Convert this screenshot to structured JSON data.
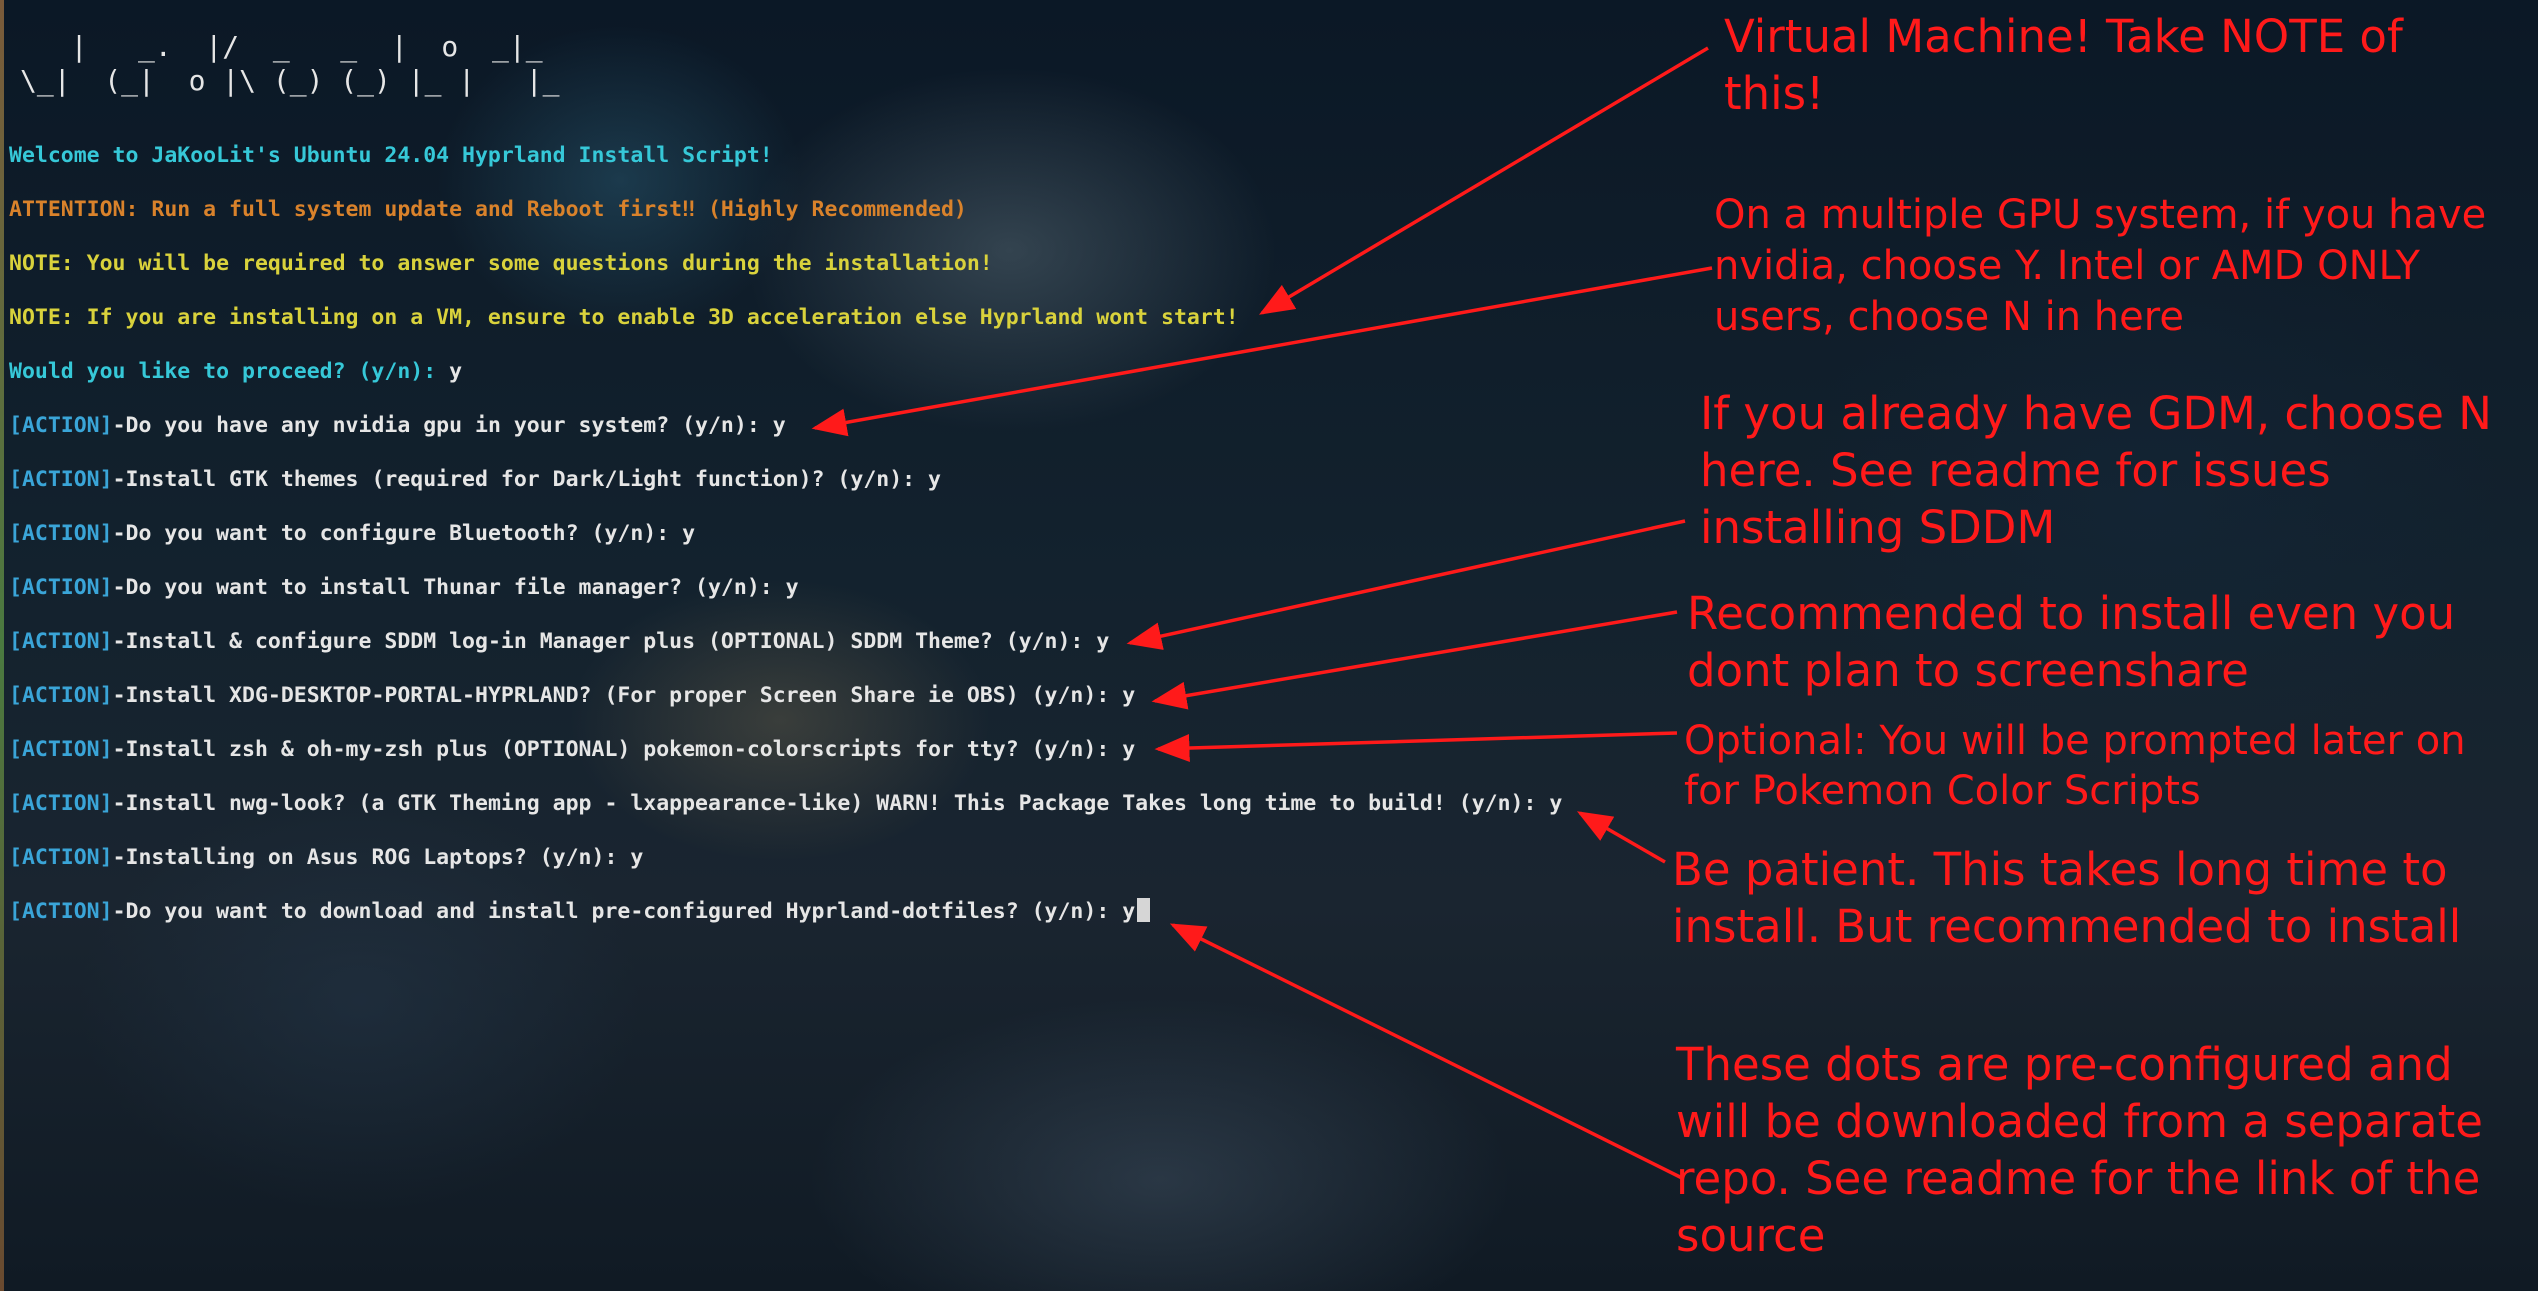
{
  "banner_art": "   |   _.  |/  _   _  |  o  _|_\n\\_|  (_|  o |\\ (_) (_) |_ |   |_",
  "lines": [
    {
      "text": "Welcome to JaKooLit's Ubuntu 24.04 Hyprland Install Script!",
      "color": "cyan"
    },
    {
      "text": "ATTENTION: Run a full system update and Reboot first‼ (Highly Recommended)",
      "color": "orange"
    },
    {
      "text": "NOTE: You will be required to answer some questions during the installation!",
      "color": "yellow"
    },
    {
      "text": "NOTE: If you are installing on a VM, ensure to enable 3D acceleration else Hyprland wont start!",
      "color": "yellow"
    },
    {
      "prompt": "Would you like to proceed? (y/n):",
      "answer": " y"
    }
  ],
  "actions": [
    {
      "tag": "[ACTION]",
      "text": "-Do you have any nvidia gpu in your system? (y/n): y"
    },
    {
      "tag": "[ACTION]",
      "text": "-Install GTK themes (required for Dark/Light function)? (y/n): y"
    },
    {
      "tag": "[ACTION]",
      "text": "-Do you want to configure Bluetooth? (y/n): y"
    },
    {
      "tag": "[ACTION]",
      "text": "-Do you want to install Thunar file manager? (y/n): y"
    },
    {
      "tag": "[ACTION]",
      "text": "-Install & configure SDDM log-in Manager plus (OPTIONAL) SDDM Theme? (y/n): y"
    },
    {
      "tag": "[ACTION]",
      "text": "-Install XDG-DESKTOP-PORTAL-HYPRLAND? (For proper Screen Share ie OBS) (y/n): y"
    },
    {
      "tag": "[ACTION]",
      "text": "-Install zsh & oh-my-zsh plus (OPTIONAL) pokemon-colorscripts for tty? (y/n): y"
    },
    {
      "tag": "[ACTION]",
      "text": "-Install nwg-look? (a GTK Theming app - lxappearance-like) WARN! This Package Takes long time to build! (y/n): y"
    },
    {
      "tag": "[ACTION]",
      "text": "-Installing on Asus ROG Laptops? (y/n): y"
    },
    {
      "tag": "[ACTION]",
      "text": "-Do you want to download and install pre-configured Hyprland-dotfiles? (y/n): y"
    }
  ],
  "annotations": [
    "Virtual Machine! Take NOTE of\nthis!",
    "On a multiple GPU system, if you have\nnvidia, choose Y. Intel or AMD ONLY\nusers, choose N in here",
    "If you already have GDM, choose N\nhere. See readme for issues\ninstalling SDDM",
    "Recommended to install even you\ndont plan to screenshare",
    "Optional: You will be prompted later on\nfor Pokemon Color Scripts",
    "Be patient. This takes long time to\ninstall. But recommended to install",
    "These dots are pre-configured and\nwill be downloaded from a separate\nrepo. See readme for the link of the\nsource"
  ],
  "colors": {
    "cyan": "#36c8d8",
    "orange": "#d9822b",
    "yellow": "#d9d23c",
    "action_tag": "#3aa5d8",
    "annotation": "#ff1a1a"
  }
}
